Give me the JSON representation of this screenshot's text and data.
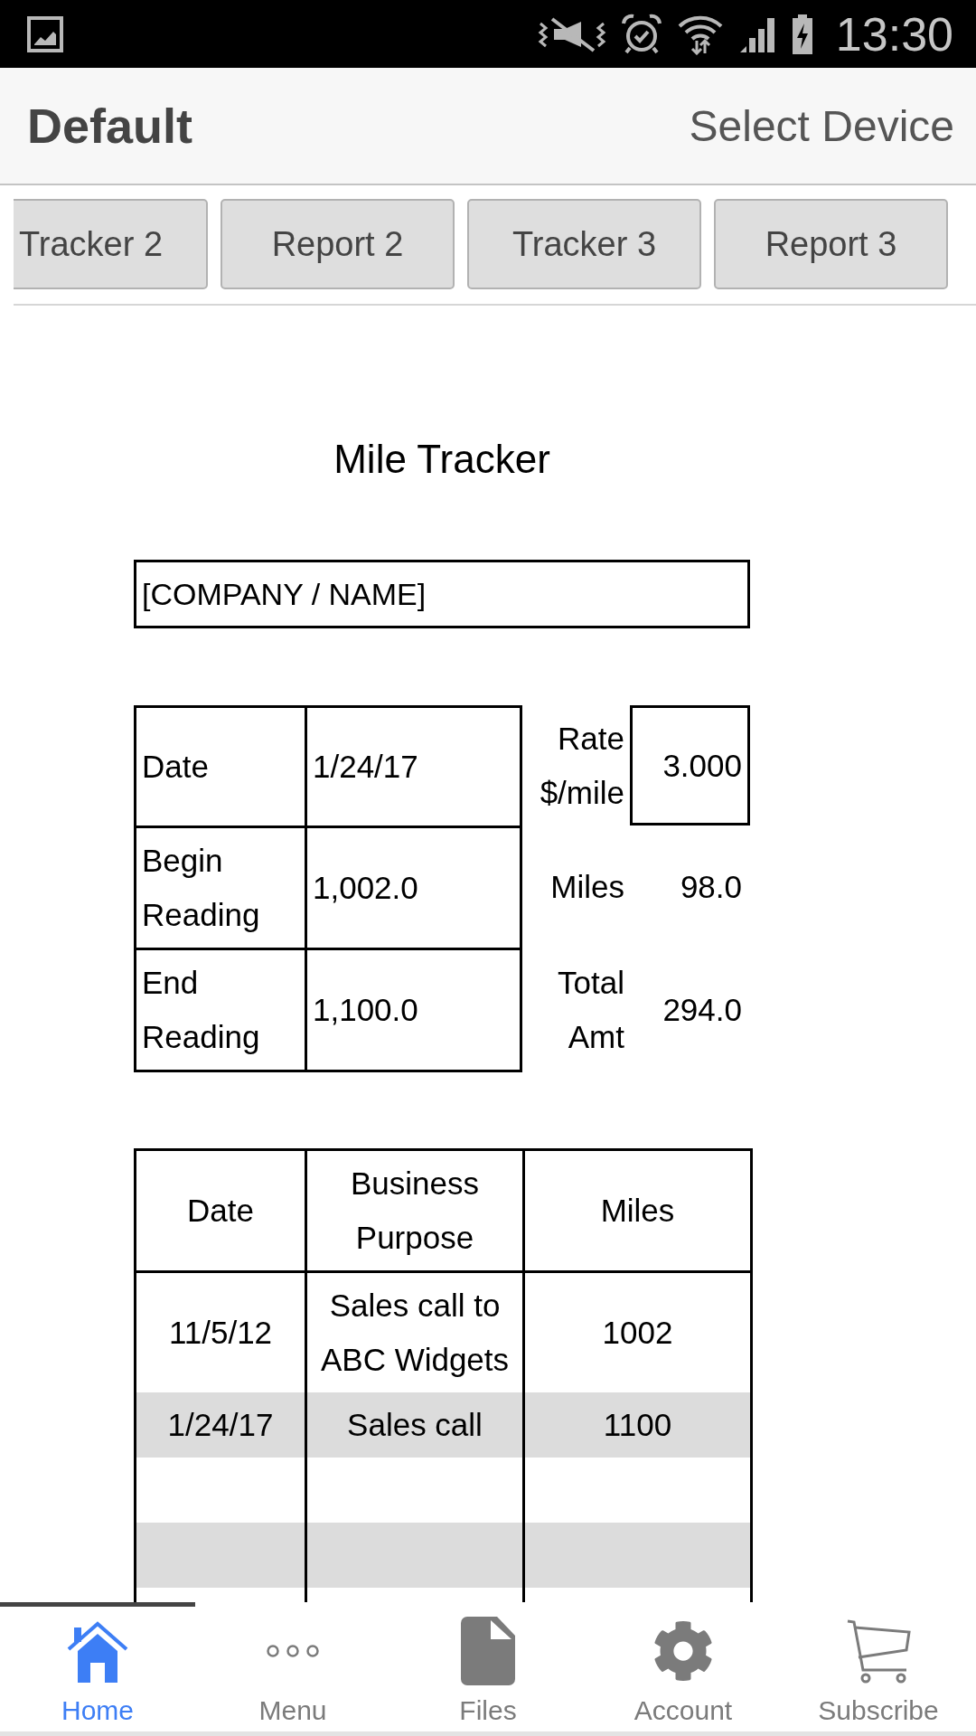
{
  "status_bar": {
    "time": "13:30"
  },
  "header": {
    "title": "Default",
    "action": "Select Device"
  },
  "tabs": [
    {
      "label": "Tracker 2",
      "selected": false
    },
    {
      "label": "Report 2",
      "selected": false
    },
    {
      "label": "Tracker 3",
      "selected": false
    },
    {
      "label": "Report 3",
      "selected": false
    }
  ],
  "sheet": {
    "title": "Mile Tracker",
    "company": "[COMPANY / NAME]",
    "summary": [
      {
        "label": "Date",
        "value": "1/24/17"
      },
      {
        "label": "Begin Reading",
        "value": "1,002.0"
      },
      {
        "label": "End Reading",
        "value": "1,100.0"
      }
    ],
    "totals": [
      {
        "label": "Rate $/mile",
        "value": "3.000",
        "kind": "boxed"
      },
      {
        "label": "Miles",
        "value": "98.0",
        "kind": "plain"
      },
      {
        "label": "Total Amt",
        "value": "294.0",
        "kind": "plain"
      }
    ],
    "log": {
      "columns": [
        "Date",
        "Business Purpose",
        "Miles"
      ],
      "rows": [
        {
          "kind": "entry",
          "cells": [
            "11/5/12",
            "Sales call to ABC Widgets",
            "1002"
          ]
        },
        {
          "kind": "entry",
          "cells": [
            "1/24/17",
            "Sales call",
            "1100"
          ]
        },
        {
          "kind": "blank"
        },
        {
          "kind": "blank"
        },
        {
          "kind": "blank"
        }
      ]
    }
  },
  "bottom_nav": [
    {
      "label": "Home",
      "selected": true
    },
    {
      "label": "Menu",
      "selected": false
    },
    {
      "label": "Files",
      "selected": false
    },
    {
      "label": "Account",
      "selected": false
    },
    {
      "label": "Subscribe",
      "selected": false
    }
  ]
}
